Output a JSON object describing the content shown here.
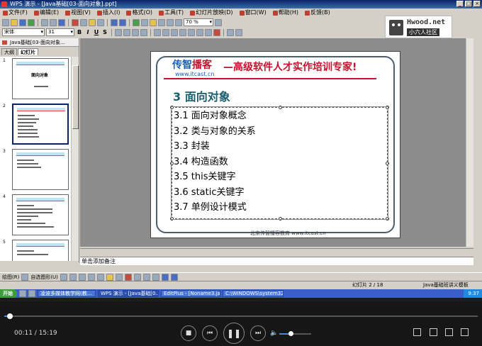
{
  "window": {
    "title": "WPS 演示 - [Java基础[03-面向对象].ppt]"
  },
  "menu": [
    "文件(F)",
    "编辑(E)",
    "视图(V)",
    "插入(I)",
    "格式(O)",
    "工具(T)",
    "幻灯片放映(D)",
    "窗口(W)",
    "帮助(H)",
    "反馈(B)"
  ],
  "toolbar": {
    "zoom": "70 %",
    "font": "宋体",
    "font_size": "31",
    "bold": "B",
    "italic": "I",
    "underline": "U",
    "shadow": "S"
  },
  "logo": {
    "title": "Hwood.net",
    "subtitle": "小六人社区"
  },
  "left_pane": {
    "doc_tab": "Java基础[03-面向对象...",
    "tabs": [
      "大纲",
      "幻灯片"
    ],
    "slides": [
      {
        "num": "1",
        "title": "面向对象"
      },
      {
        "num": "2",
        "title": ""
      },
      {
        "num": "3",
        "title": ""
      },
      {
        "num": "4",
        "title": ""
      },
      {
        "num": "5",
        "title": ""
      }
    ]
  },
  "slide": {
    "brand": "传智",
    "brand_highlight": "播客",
    "brand_url": "www.itcast.cn",
    "slogan": "—高级软件人才实作培训专家!",
    "title": "3 面向对象",
    "items": [
      "3.1 面向对象概念",
      "3.2 类与对象的关系",
      "3.3 封装",
      "3.4 构造函数",
      "3.5 this关键字",
      "3.6 static关键字",
      "3.7 单例设计模式"
    ],
    "footer": "北京传智播客教育  www.itcast.cn"
  },
  "notes": {
    "placeholder": "单击添加备注"
  },
  "draw_toolbar": {
    "draw": "绘图(R)",
    "autoshape": "自选图形(U)"
  },
  "status": {
    "slide_position": "幻灯片 2 / 18",
    "template": "Java基础班讲义模板"
  },
  "taskbar": {
    "start": "开始",
    "tasks": [
      {
        "label": "凌波多媒体教学网(教...",
        "active": false
      },
      {
        "label": "WPS 演示 - [Java基础[0...",
        "active": true
      },
      {
        "label": "EditPlus - [Noname3.java]",
        "active": false
      },
      {
        "label": "C:\\WINDOWS\\system32...",
        "active": false
      }
    ],
    "clock": "9:37"
  },
  "player": {
    "elapsed": "00:11",
    "total": "15:19",
    "progress": 0.012,
    "volume": 0.35
  },
  "colors": {
    "brand_blue": "#1a5fb4",
    "brand_red": "#c8102e",
    "accent": "#3a8ee8"
  }
}
